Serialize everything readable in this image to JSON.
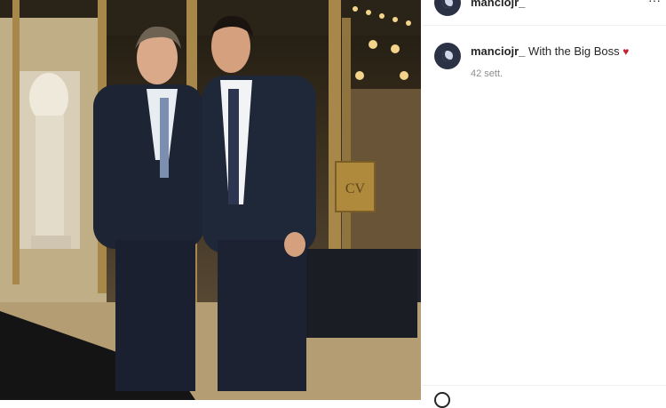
{
  "post": {
    "author": "manciojr_",
    "caption_user": "manciojr_",
    "caption_text": "With the Big Boss",
    "heart": "♥",
    "time": "42 sett.",
    "more_icon": "···"
  },
  "photo": {
    "description_icon": "photo"
  }
}
